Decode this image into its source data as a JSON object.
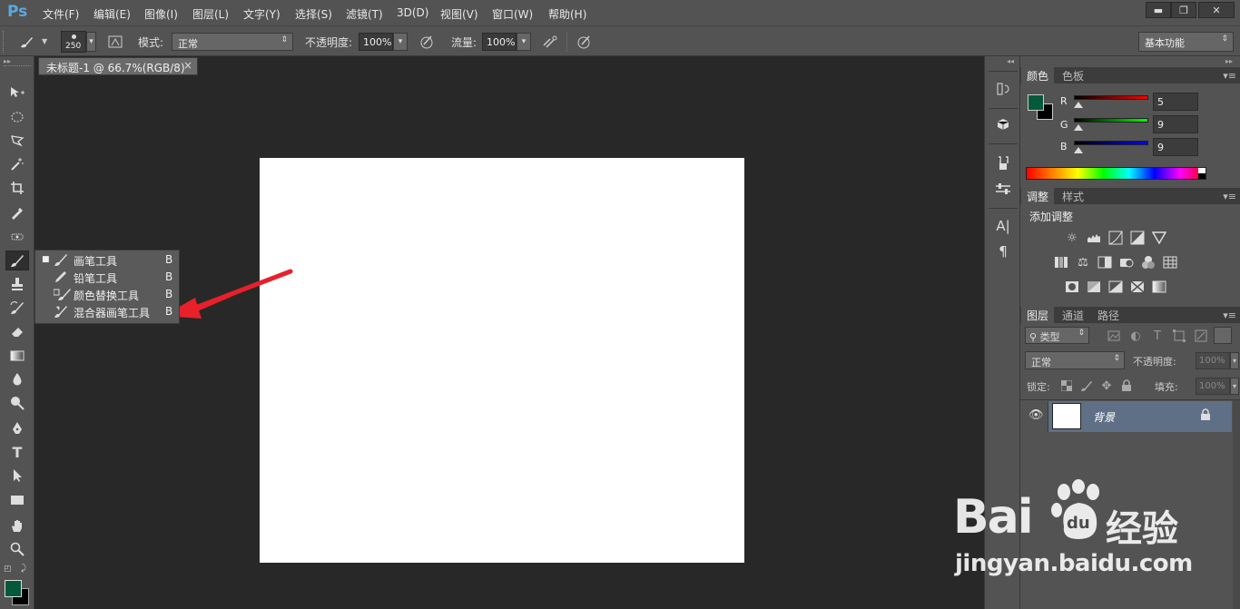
{
  "app": {
    "logo": "Ps"
  },
  "menubar": {
    "items": [
      "文件(F)",
      "编辑(E)",
      "图像(I)",
      "图层(L)",
      "文字(Y)",
      "选择(S)",
      "滤镜(T)",
      "3D(D)",
      "视图(V)",
      "窗口(W)",
      "帮助(H)"
    ],
    "window_controls": {
      "minimize": "▬",
      "restore": "❐",
      "close": "✕"
    }
  },
  "options": {
    "brush_size": "250",
    "mode_label": "模式:",
    "mode_value": "正常",
    "opacity_label": "不透明度:",
    "opacity_value": "100%",
    "flow_label": "流量:",
    "flow_value": "100%",
    "workspace": "基本功能"
  },
  "document": {
    "tab_title": "未标题-1 @ 66.7%(RGB/8)",
    "close_glyph": "×"
  },
  "flyout": {
    "items": [
      {
        "label": "画笔工具",
        "shortcut": "B",
        "selected": true,
        "icon": "brush-icon"
      },
      {
        "label": "铅笔工具",
        "shortcut": "B",
        "selected": false,
        "icon": "pencil-icon"
      },
      {
        "label": "颜色替换工具",
        "shortcut": "B",
        "selected": false,
        "icon": "color-replacement-icon"
      },
      {
        "label": "混合器画笔工具",
        "shortcut": "B",
        "selected": false,
        "icon": "mixer-brush-icon"
      }
    ],
    "selected_marker": "■"
  },
  "color_panel": {
    "tabs": [
      "颜色",
      "色板"
    ],
    "foreground": "#05593a",
    "background": "#000000",
    "channels": [
      {
        "label": "R",
        "value": "5",
        "track": "#ff0000"
      },
      {
        "label": "G",
        "value": "9",
        "track": "#00ff00"
      },
      {
        "label": "B",
        "value": "9",
        "track": "#0000ff"
      }
    ]
  },
  "adjustments_panel": {
    "tabs": [
      "调整",
      "样式"
    ],
    "title": "添加调整"
  },
  "layers_panel": {
    "tabs": [
      "图层",
      "通道",
      "路径"
    ],
    "filter_label": "类型",
    "blend_mode": "正常",
    "opacity_label": "不透明度:",
    "opacity_value": "100%",
    "lock_label": "锁定:",
    "fill_label": "填充:",
    "fill_value": "100%",
    "layers": [
      {
        "name": "背景",
        "visible": true,
        "locked": true
      }
    ]
  },
  "watermark": {
    "brand": "Bai",
    "brand_suffix": "经验",
    "paw_text": "du",
    "url": "jingyan.baidu.com"
  },
  "colors": {
    "ui_bg": "#535353",
    "doc_bg": "#282828",
    "accent_arrow": "#e8202a"
  }
}
